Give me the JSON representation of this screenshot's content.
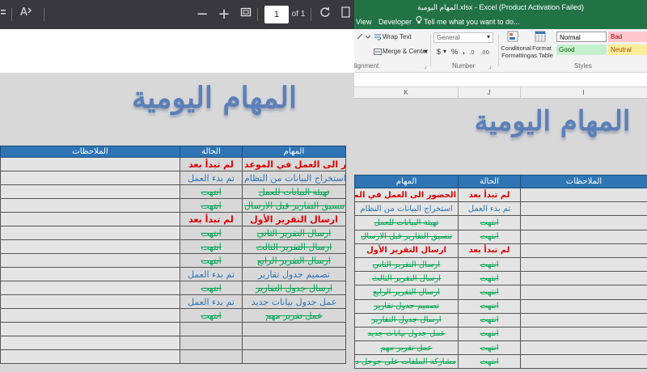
{
  "pdf_viewer": {
    "zoom_out": "−",
    "zoom_in": "+",
    "page_number": "1",
    "page_total": "of 1",
    "doc_title": "المهام اليومية",
    "table_headers": {
      "notes": "الملاحظات",
      "status": "الحالة",
      "task": "المهام"
    },
    "rows": [
      {
        "task": "الحضور الى العمل في الموعد",
        "status": "لم تبدأ بعد",
        "task_state": "urgent",
        "status_state": "notstarted"
      },
      {
        "task": "استخراج البيانات من النظام",
        "status": "تم بدء العمل",
        "task_state": "progress",
        "status_state": "inprogress"
      },
      {
        "task": "تهيئة البيانات للعمل",
        "status": "انتهت",
        "task_state": "done",
        "status_state": "done"
      },
      {
        "task": "تنسيق التقارير قبل الارسال",
        "status": "انتهت",
        "task_state": "done",
        "status_state": "done"
      },
      {
        "task": "ارسال التقرير الأول",
        "status": "لم تبدأ بعد",
        "task_state": "urgent",
        "status_state": "notstarted"
      },
      {
        "task": "ارسال التقرير الثاني",
        "status": "انتهت",
        "task_state": "done",
        "status_state": "done"
      },
      {
        "task": "ارسال التقرير الثالث",
        "status": "انتهت",
        "task_state": "done",
        "status_state": "done"
      },
      {
        "task": "ارسال التقرير الرابع",
        "status": "انتهت",
        "task_state": "done",
        "status_state": "done"
      },
      {
        "task": "تصميم جدول تقارير",
        "status": "تم بدء العمل",
        "task_state": "progress",
        "status_state": "inprogress"
      },
      {
        "task": "ارسال جدول التقارير",
        "status": "انتهت",
        "task_state": "done",
        "status_state": "done"
      },
      {
        "task": "عمل جدول بيانات جديد",
        "status": "تم بدء العمل",
        "task_state": "progress",
        "status_state": "inprogress"
      },
      {
        "task": "عمل تقرير مهم",
        "status": "انتهت",
        "task_state": "done",
        "status_state": "done"
      },
      {
        "task": "",
        "status": "",
        "task_state": "",
        "status_state": ""
      },
      {
        "task": "",
        "status": "",
        "task_state": "",
        "status_state": ""
      },
      {
        "task": "",
        "status": "",
        "task_state": "",
        "status_state": ""
      }
    ]
  },
  "excel": {
    "window_title": "المهام اليومية.xlsx - Excel (Product Activation Failed)",
    "tabs": {
      "view": "View",
      "developer": "Developer",
      "tell_me": "Tell me what you want to do..."
    },
    "ribbon": {
      "wrap_text": "Wrap Text",
      "merge_center": "Merge & Center",
      "number_format": "General",
      "currency": "$",
      "percent": "%",
      "comma": ",",
      "conditional_formatting": "Conditional Formatting",
      "format_as_table": "Format as Table",
      "style_normal": "Normal",
      "style_bad": "Bad",
      "style_good": "Good",
      "style_neutral": "Neutral",
      "group_alignment": "lignment",
      "group_number": "Number",
      "group_styles": "Styles"
    },
    "columns": {
      "k": "K",
      "j": "J",
      "i": "I"
    },
    "doc_title": "المهام اليومية",
    "table_headers": {
      "notes": "الملاحظات",
      "status": "الحالة",
      "task": "المهام"
    },
    "rows": [
      {
        "task": "الحضور الى العمل في الموعد",
        "status": "لم تبدأ بعد",
        "task_state": "urgent",
        "status_state": "notstarted"
      },
      {
        "task": "استخراج البيانات من النظام",
        "status": "تم بدء العمل",
        "task_state": "progress",
        "status_state": "inprogress"
      },
      {
        "task": "تهيئة البيانات للعمل",
        "status": "انتهت",
        "task_state": "done",
        "status_state": "done"
      },
      {
        "task": "تنسيق التقارير قبل الارسال",
        "status": "انتهت",
        "task_state": "done",
        "status_state": "done"
      },
      {
        "task": "ارسال التقرير الأول",
        "status": "لم تبدأ بعد",
        "task_state": "urgent",
        "status_state": "notstarted"
      },
      {
        "task": "ارسال التقرير الثاني",
        "status": "انتهت",
        "task_state": "done",
        "status_state": "done"
      },
      {
        "task": "ارسال التقرير الثالث",
        "status": "انتهت",
        "task_state": "done",
        "status_state": "done"
      },
      {
        "task": "ارسال التقرير الرابع",
        "status": "انتهت",
        "task_state": "done",
        "status_state": "done"
      },
      {
        "task": "تصميم جدول تقارير",
        "status": "انتهت",
        "task_state": "done",
        "status_state": "done"
      },
      {
        "task": "ارسال جدول التقارير",
        "status": "انتهت",
        "task_state": "done",
        "status_state": "done"
      },
      {
        "task": "عمل جدول بيانات جديد",
        "status": "انتهت",
        "task_state": "done",
        "status_state": "done"
      },
      {
        "task": "عمل تقرير مهم",
        "status": "انتهت",
        "task_state": "done",
        "status_state": "done"
      },
      {
        "task": "مشاركة الملفات على جوجل درايف",
        "status": "انتهت",
        "task_state": "done",
        "status_state": "done"
      }
    ]
  }
}
